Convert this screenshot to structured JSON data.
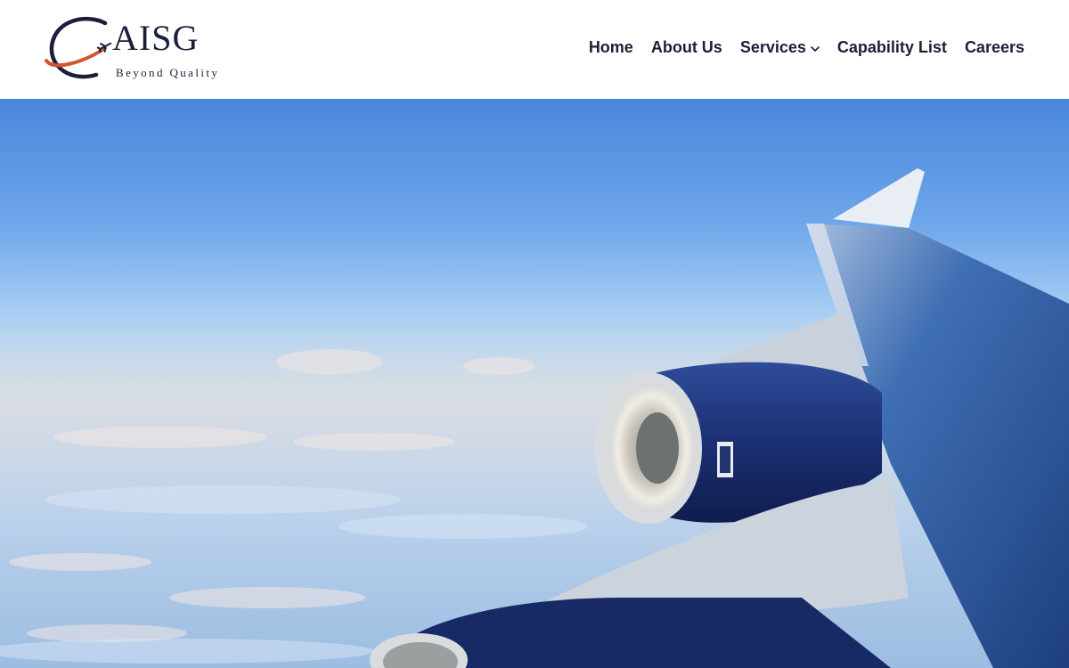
{
  "logo": {
    "name": "AISG",
    "tagline": "Beyond Quality"
  },
  "nav": {
    "items": [
      {
        "label": "Home",
        "has_dropdown": false
      },
      {
        "label": "About Us",
        "has_dropdown": false
      },
      {
        "label": "Services",
        "has_dropdown": true
      },
      {
        "label": "Capability List",
        "has_dropdown": false
      },
      {
        "label": "Careers",
        "has_dropdown": false
      }
    ]
  },
  "colors": {
    "brand_navy": "#1b1f3a",
    "brand_orange": "#d2552f",
    "header_bg": "#ffffff"
  },
  "icons": {
    "logo_mark": "orbit-with-airplane-icon",
    "dropdown": "chevron-down-icon"
  }
}
